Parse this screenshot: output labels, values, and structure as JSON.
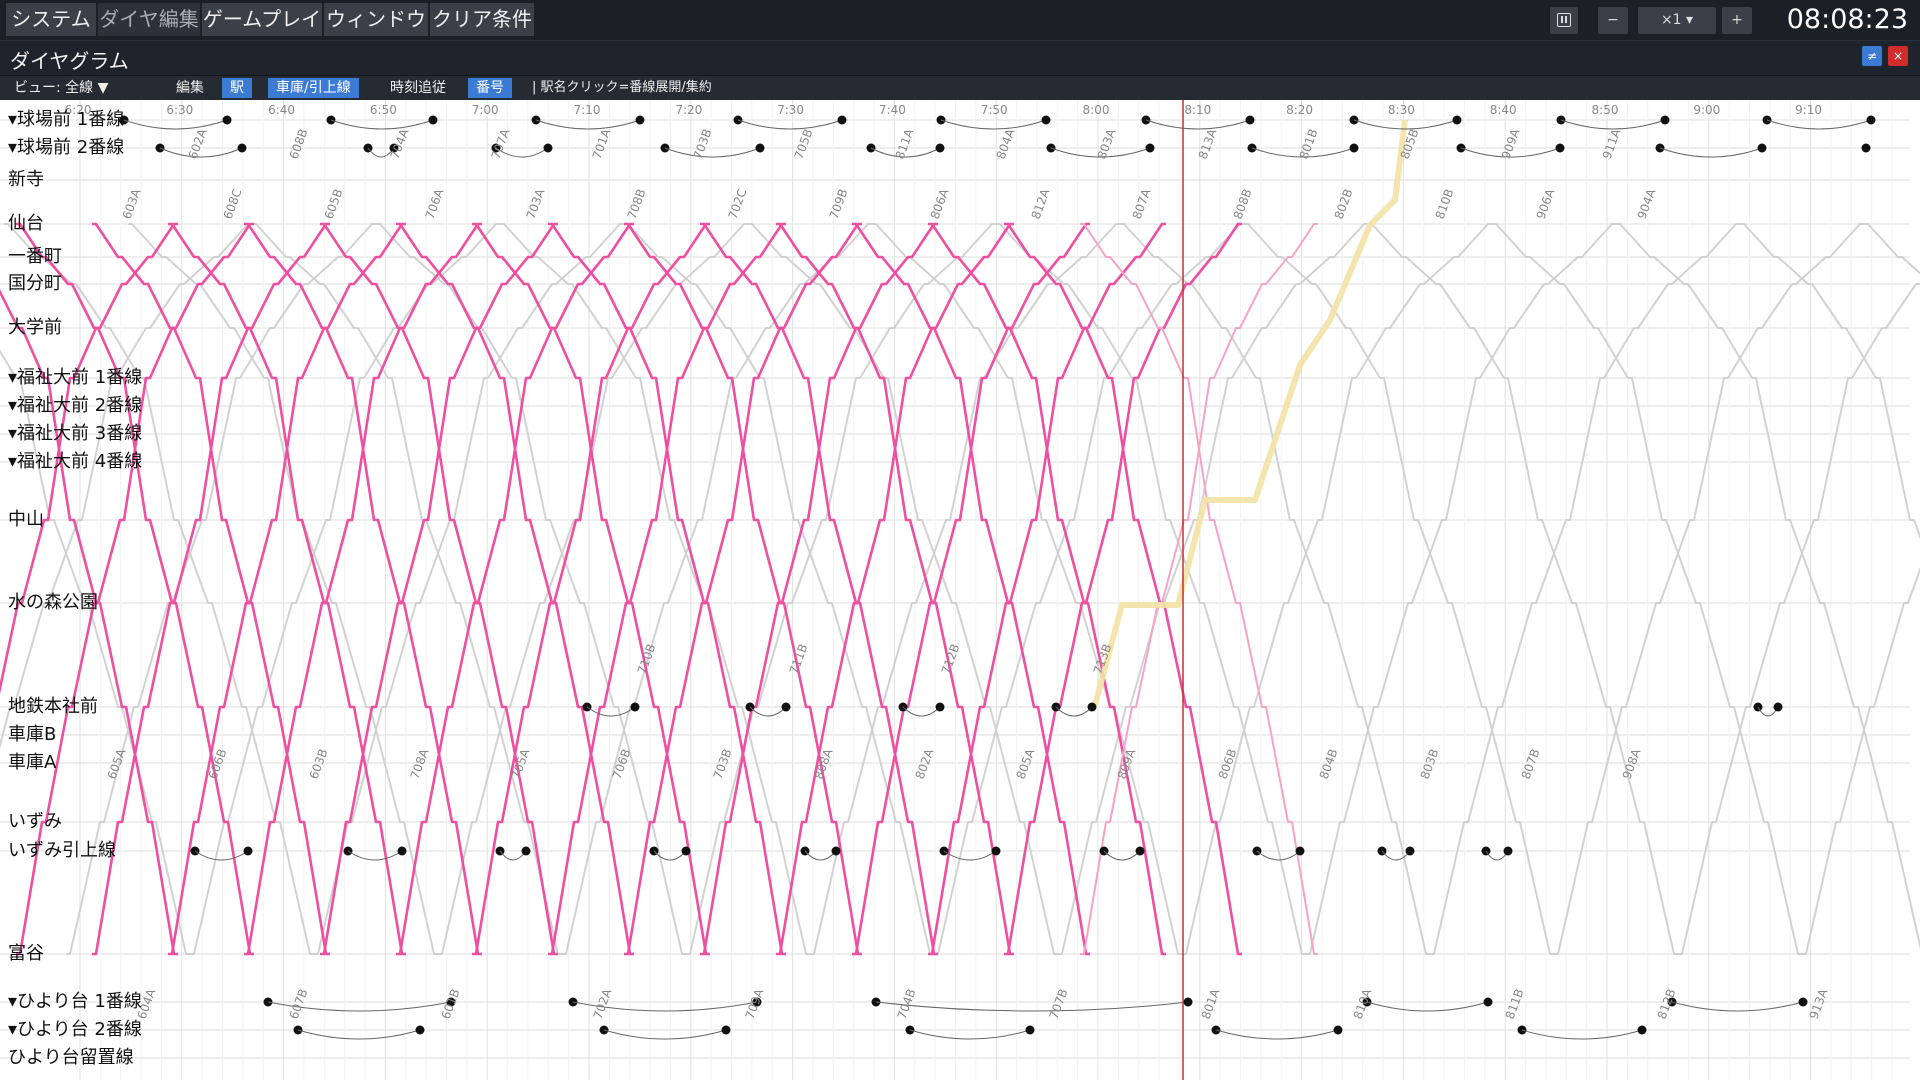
{
  "menu": {
    "system": "システム",
    "dia_edit": "ダイヤ編集",
    "gameplay": "ゲームプレイ",
    "window": "ウィンドウ",
    "clear_cond": "クリア条件"
  },
  "controls": {
    "pause_icon": "pause-icon",
    "minus": "−",
    "speed": "×1 ▾",
    "plus": "+",
    "clock": "08:08:23"
  },
  "panel": {
    "title": "ダイヤグラム",
    "pin_glyph": "≠",
    "close_glyph": "×"
  },
  "toolbar": {
    "view": "ビュー: 全線 ▼",
    "edit": "編集",
    "station": "駅",
    "depot": "車庫/引上線",
    "follow": "時刻追従",
    "number": "番号",
    "hint": "| 駅名クリック=番線展開/集約"
  },
  "time_ticks": [
    "6:20",
    "6:30",
    "6:40",
    "6:50",
    "7:00",
    "7:10",
    "7:20",
    "7:30",
    "7:40",
    "7:50",
    "8:00",
    "8:10",
    "8:20",
    "8:30",
    "8:40",
    "8:50",
    "9:00",
    "9:10"
  ],
  "stations": [
    {
      "label": "▾球場前 1番線"
    },
    {
      "label": "▾球場前 2番線"
    },
    {
      "label": "新寺"
    },
    {
      "label": "仙台"
    },
    {
      "label": "一番町"
    },
    {
      "label": "国分町"
    },
    {
      "label": "大学前"
    },
    {
      "label": "▾福祉大前 1番線"
    },
    {
      "label": "▾福祉大前 2番線"
    },
    {
      "label": "▾福祉大前 3番線"
    },
    {
      "label": "▾福祉大前 4番線"
    },
    {
      "label": "中山"
    },
    {
      "label": "水の森公園"
    },
    {
      "label": "地鉄本社前"
    },
    {
      "label": "車庫B"
    },
    {
      "label": "車庫A"
    },
    {
      "label": "いずみ"
    },
    {
      "label": "いずみ引上線"
    },
    {
      "label": "富谷"
    },
    {
      "label": "▾ひより台 1番線"
    },
    {
      "label": "▾ひより台 2番線"
    },
    {
      "label": "ひより台留置線"
    }
  ],
  "train_labels_top": [
    "602A",
    "608B",
    "704A",
    "707A",
    "701A",
    "703B",
    "705B",
    "811A",
    "804A",
    "803A",
    "813A",
    "801B",
    "805B",
    "909A",
    "911A"
  ],
  "train_labels_mid": [
    "603A",
    "608C",
    "605B",
    "706A",
    "703A",
    "708B",
    "702C",
    "709B",
    "806A",
    "812A",
    "807A",
    "808B",
    "802B",
    "810B",
    "906A",
    "904A"
  ],
  "train_labels_bottom": [
    "605A",
    "606B",
    "603B",
    "708A",
    "705A",
    "706B",
    "703B",
    "808A",
    "802A",
    "805A",
    "809A",
    "806B",
    "804B",
    "803B",
    "807B",
    "908A"
  ],
  "train_labels_lower": [
    "604A",
    "607B",
    "601B",
    "702A",
    "709A",
    "704B",
    "707B",
    "801A",
    "810A",
    "811B",
    "812B",
    "913A"
  ],
  "train_labels_center": [
    "710B",
    "711B",
    "712B",
    "713B"
  ],
  "colors": {
    "pink": "#ee4fa0",
    "pink_light": "#f6a3c8",
    "gray": "#cdcdcd",
    "highlight": "#f3e2a6",
    "current_time": "#c23030"
  }
}
